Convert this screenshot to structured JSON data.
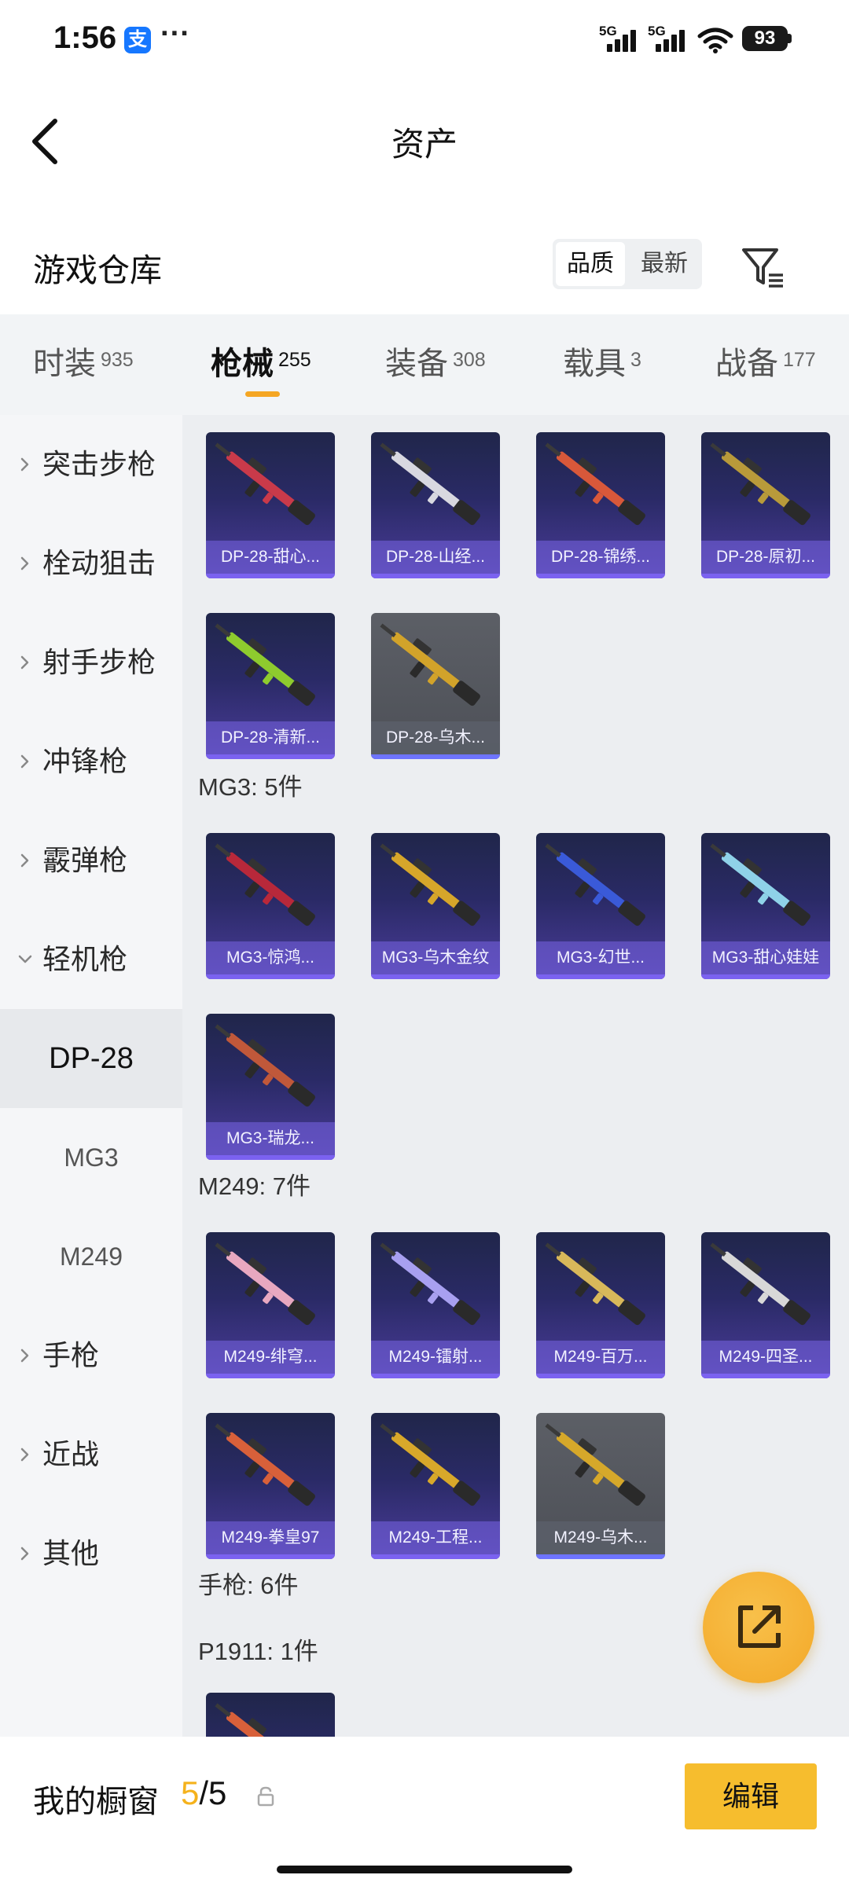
{
  "status_bar": {
    "time": "1:56",
    "alipay_icon": "支",
    "dots": "···",
    "net1": "5G",
    "net2": "5G",
    "battery": "93"
  },
  "nav": {
    "title": "资产",
    "back_icon": "chevron-left-icon"
  },
  "warehouse": {
    "title": "游戏仓库",
    "sort_options": [
      "品质",
      "最新"
    ],
    "active_sort": "品质",
    "filter_icon": "filter-icon"
  },
  "tabs": [
    {
      "label": "时装",
      "count": "935"
    },
    {
      "label": "枪械",
      "count": "255"
    },
    {
      "label": "装备",
      "count": "308"
    },
    {
      "label": "载具",
      "count": "3"
    },
    {
      "label": "战备",
      "count": "177"
    }
  ],
  "active_tab": "枪械",
  "sidebar": [
    {
      "label": "突击步枪",
      "type": "category",
      "expanded": false
    },
    {
      "label": "栓动狙击",
      "type": "category",
      "expanded": false
    },
    {
      "label": "射手步枪",
      "type": "category",
      "expanded": false
    },
    {
      "label": "冲锋枪",
      "type": "category",
      "expanded": false
    },
    {
      "label": "霰弹枪",
      "type": "category",
      "expanded": false
    },
    {
      "label": "轻机枪",
      "type": "category",
      "expanded": true
    },
    {
      "label": "DP-28",
      "type": "sub",
      "selected": true
    },
    {
      "label": "MG3",
      "type": "sub",
      "selected": false
    },
    {
      "label": "M249",
      "type": "sub",
      "selected": false
    },
    {
      "label": "手枪",
      "type": "category",
      "expanded": false
    },
    {
      "label": "近战",
      "type": "category",
      "expanded": false
    },
    {
      "label": "其他",
      "type": "category",
      "expanded": false
    }
  ],
  "sections": {
    "mg3": "MG3: 5件",
    "m249": "M249: 7件",
    "pistol": "手枪: 6件",
    "p1911": "P1911: 1件"
  },
  "items": {
    "dp28": [
      {
        "name": "DP-28-甜心...",
        "rarity": "purple",
        "accent": "#c93a4a"
      },
      {
        "name": "DP-28-山经...",
        "rarity": "purple",
        "accent": "#d8d8e0"
      },
      {
        "name": "DP-28-锦绣...",
        "rarity": "purple",
        "accent": "#d8583a"
      },
      {
        "name": "DP-28-原初...",
        "rarity": "purple",
        "accent": "#b89a3a"
      },
      {
        "name": "DP-28-清新...",
        "rarity": "purple",
        "accent": "#8ecb2e"
      },
      {
        "name": "DP-28-乌木...",
        "rarity": "gray",
        "accent": "#d2a32a"
      }
    ],
    "mg3": [
      {
        "name": "MG3-惊鸿...",
        "rarity": "purple",
        "accent": "#b8283a"
      },
      {
        "name": "MG3-乌木金纹",
        "rarity": "purple",
        "accent": "#d6a62a"
      },
      {
        "name": "MG3-幻世...",
        "rarity": "purple",
        "accent": "#3a5ad8"
      },
      {
        "name": "MG3-甜心娃娃",
        "rarity": "purple",
        "accent": "#8fd2e8"
      },
      {
        "name": "MG3-瑞龙...",
        "rarity": "purple",
        "accent": "#c0583a"
      }
    ],
    "m249": [
      {
        "name": "M249-绯穹...",
        "rarity": "purple",
        "accent": "#e8a8c0"
      },
      {
        "name": "M249-镭射...",
        "rarity": "purple",
        "accent": "#a8a0f0"
      },
      {
        "name": "M249-百万...",
        "rarity": "purple",
        "accent": "#d8b85a"
      },
      {
        "name": "M249-四圣...",
        "rarity": "purple",
        "accent": "#d8d8d8"
      },
      {
        "name": "M249-拳皇97",
        "rarity": "purple",
        "accent": "#d8603a"
      },
      {
        "name": "M249-工程...",
        "rarity": "purple",
        "accent": "#d8a82a"
      },
      {
        "name": "M249-乌木...",
        "rarity": "gray",
        "accent": "#d6a82a"
      }
    ],
    "p1911": [
      {
        "name": "",
        "rarity": "purple",
        "accent": "#d8603a"
      }
    ]
  },
  "fab": {
    "icon": "share-external-icon"
  },
  "bottom_bar": {
    "label": "我的橱窗",
    "current": "5",
    "separator": "/",
    "total": "5",
    "edit_label": "编辑",
    "lock_icon": "lock-icon"
  }
}
